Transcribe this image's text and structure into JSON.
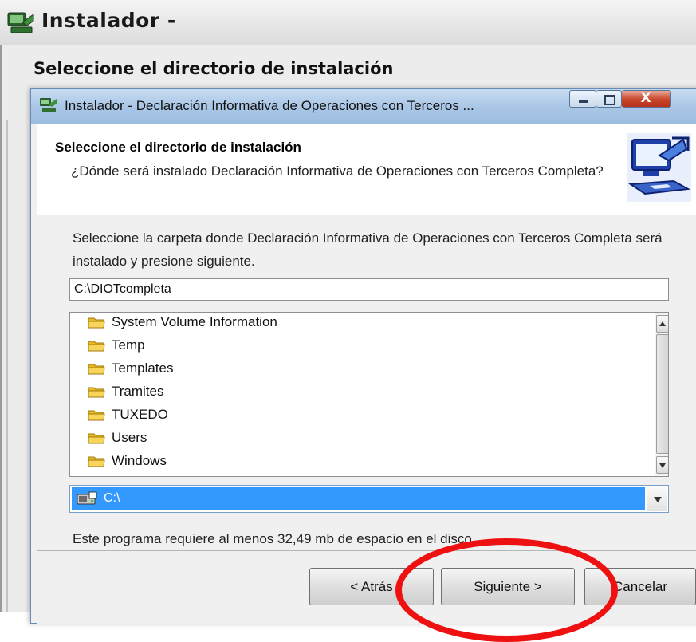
{
  "back_window": {
    "title": "Instalador -",
    "heading": "Seleccione el directorio de instalación"
  },
  "dialog": {
    "title": "Instalador - Declaración Informativa de Operaciones con Terceros ...",
    "close_glyph": "X",
    "header": {
      "title": "Seleccione el directorio de instalación",
      "subtitle": "¿Dónde será instalado Declaración Informativa de Operaciones con Terceros Completa?",
      "icon": "computer-install-icon"
    },
    "intro_text": "Seleccione la carpeta donde Declaración Informativa de Operaciones con Terceros Completa será instalado y presione siguiente.",
    "path_value": "C:\\DIOTcompleta",
    "folders": [
      "System Volume Information",
      "Temp",
      "Templates",
      "Tramites",
      "TUXEDO",
      "Users",
      "Windows"
    ],
    "drive": {
      "label": "C:\\",
      "icon": "drive-icon"
    },
    "space_note": "Este programa requiere al menos 32,49 mb de espacio en el disco.",
    "buttons": {
      "back": "< Atrás",
      "next": "Siguiente >",
      "cancel": "Cancelar"
    }
  },
  "colors": {
    "selection": "#3399ff",
    "annotation_circle": "#ee1111",
    "titlebar": "#a9c6e6"
  }
}
